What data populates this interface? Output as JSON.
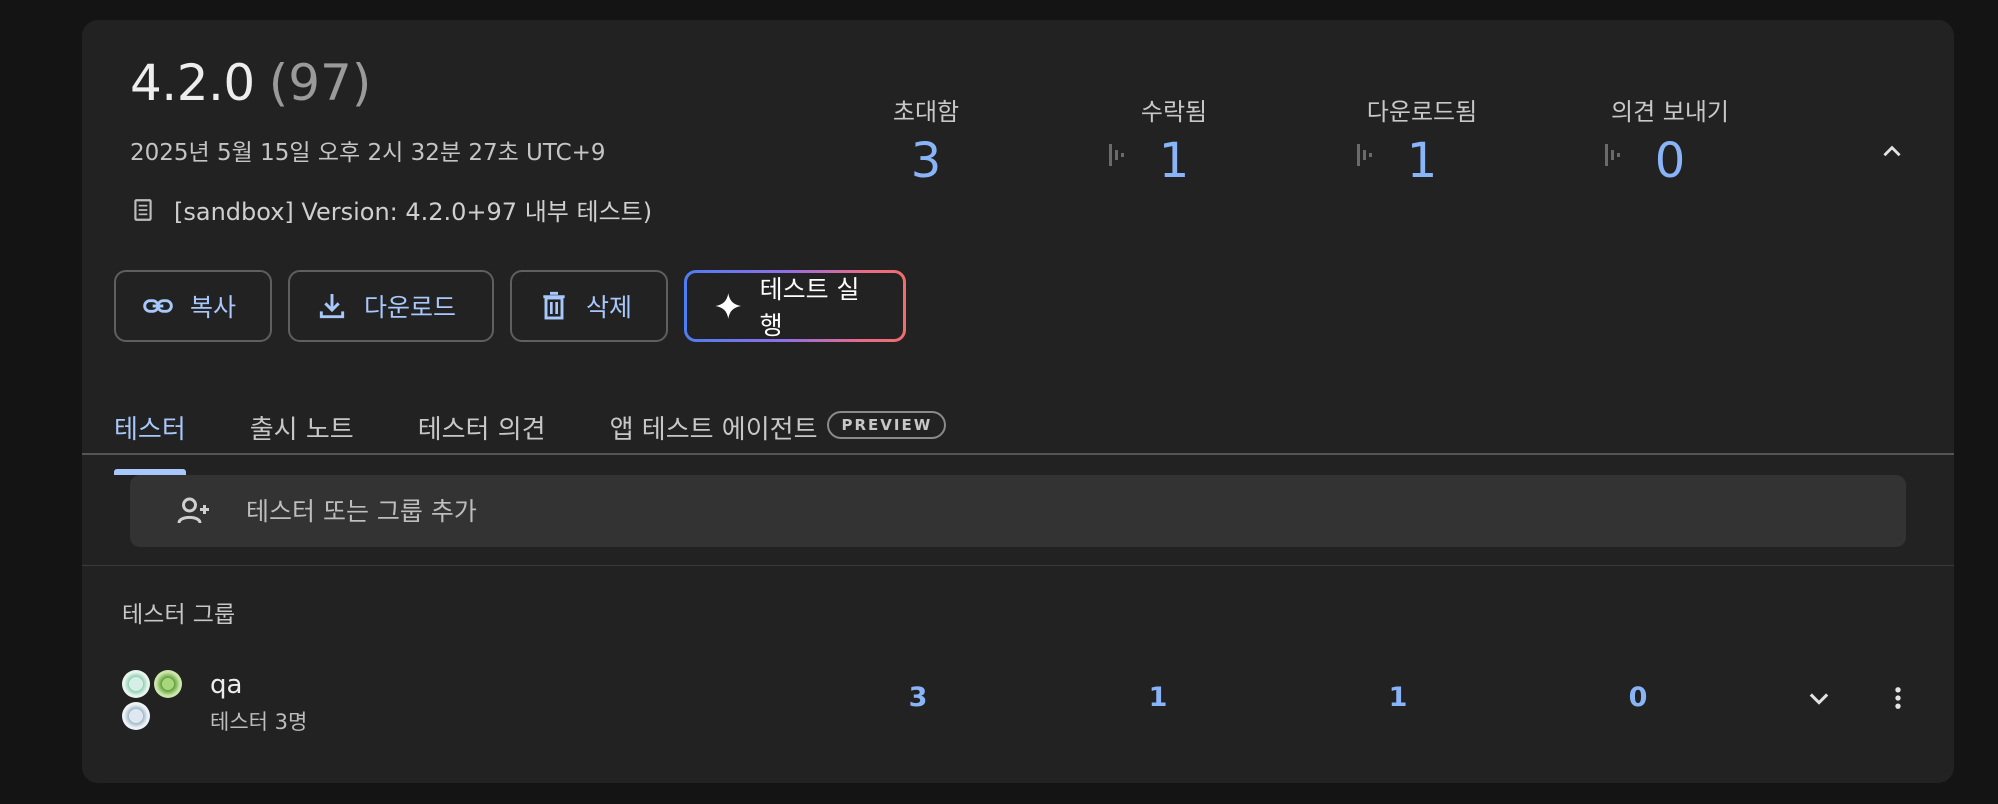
{
  "release": {
    "version": "4.2.0",
    "build": "(97)",
    "date": "2025년 5월 15일 오후 2시 32분 27초 UTC+9",
    "note": "[sandbox] Version: 4.2.0+97 내부 테스트)"
  },
  "stats": [
    {
      "label": "초대함",
      "value": "3"
    },
    {
      "label": "수락됨",
      "value": "1"
    },
    {
      "label": "다운로드됨",
      "value": "1"
    },
    {
      "label": "의견 보내기",
      "value": "0"
    }
  ],
  "actions": {
    "copy_label": "복사",
    "download_label": "다운로드",
    "delete_label": "삭제",
    "run_test_label": "테스트 실행"
  },
  "tabs": [
    {
      "label": "테스터",
      "active": true
    },
    {
      "label": "출시 노트",
      "active": false
    },
    {
      "label": "테스터 의견",
      "active": false
    },
    {
      "label": "앱 테스트 에이전트",
      "active": false,
      "badge": "PREVIEW"
    }
  ],
  "search": {
    "placeholder": "테스터 또는 그룹 추가",
    "value": ""
  },
  "groups_section": {
    "header": "테스터 그룹",
    "groups": [
      {
        "name": "qa",
        "subtitle": "테스터 3명",
        "invited": "3",
        "accepted": "1",
        "downloaded": "1",
        "feedback": "0"
      }
    ]
  },
  "icons": {
    "note": "note-icon",
    "copy": "link-icon",
    "download": "download-icon",
    "delete": "trash-icon",
    "run": "sparkle-icon",
    "add_person": "person-add-icon",
    "collapse": "chevron-up-icon",
    "expand": "chevron-down-icon",
    "more": "more-vert-icon"
  },
  "colors": {
    "accent": "#8ab4f8",
    "card_bg": "#222222",
    "page_bg": "#141414"
  }
}
